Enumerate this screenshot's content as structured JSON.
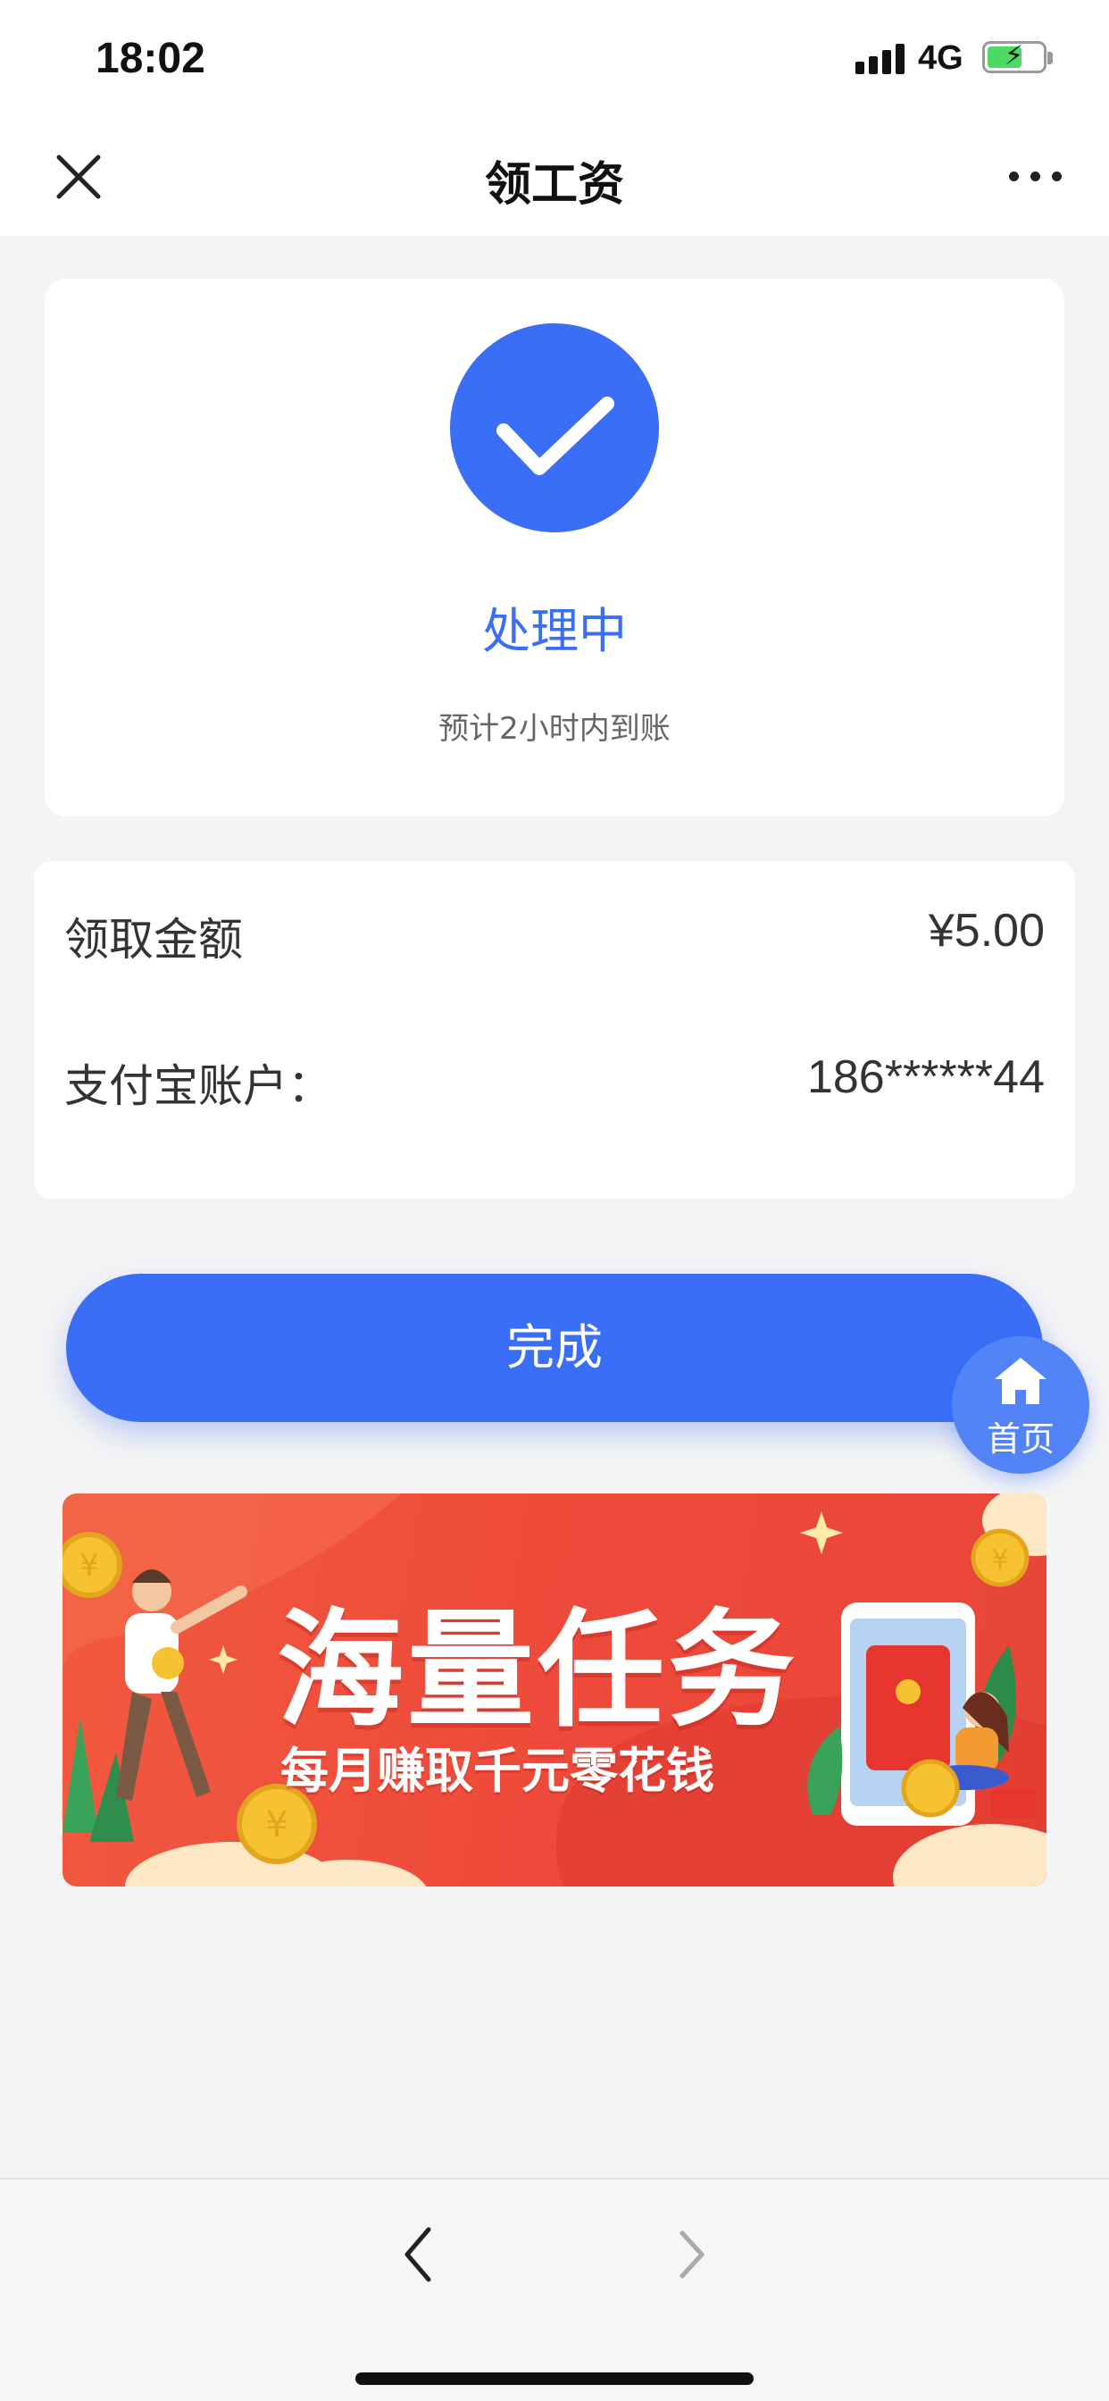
{
  "status_bar": {
    "time": "18:02",
    "network": "4G",
    "icons": [
      "signal-icon",
      "battery-charging-icon"
    ]
  },
  "nav": {
    "title": "领工资",
    "left_icon": "close-icon",
    "right_icon": "more-icon"
  },
  "status": {
    "icon": "check-icon",
    "title": "处理中",
    "subtitle": "预计2小时内到账",
    "accent_color": "#3a6ef6"
  },
  "info": {
    "rows": [
      {
        "label": "领取金额",
        "value": "¥5.00"
      },
      {
        "label": "支付宝账户：",
        "value": "186******44"
      }
    ]
  },
  "actions": {
    "done_label": "完成",
    "home_label": "首页",
    "home_icon": "home-icon"
  },
  "promo": {
    "title": "海量任务",
    "subtitle": "每月赚取千元零花钱",
    "background_color": "#ef4b3b"
  },
  "toolbar": {
    "back_icon": "chevron-left-icon",
    "forward_icon": "chevron-right-icon"
  }
}
